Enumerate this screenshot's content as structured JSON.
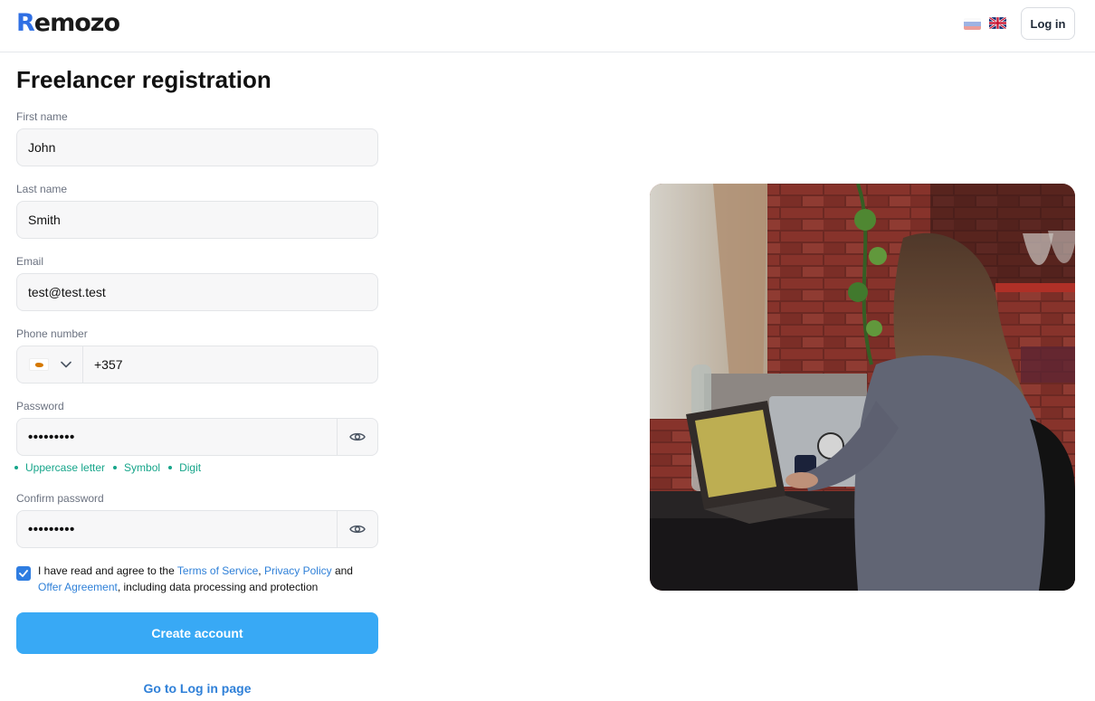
{
  "header": {
    "logo_initial": "R",
    "logo_rest": "emozo",
    "login_label": "Log in"
  },
  "form": {
    "title": "Freelancer registration",
    "first_name": {
      "label": "First name",
      "value": "John"
    },
    "last_name": {
      "label": "Last name",
      "value": "Smith"
    },
    "email": {
      "label": "Email",
      "value": "test@test.test"
    },
    "phone": {
      "label": "Phone number",
      "value": "+357"
    },
    "password": {
      "label": "Password",
      "value": "•••••••••"
    },
    "password_hints": [
      "Uppercase letter",
      "Symbol",
      "Digit"
    ],
    "confirm_password": {
      "label": "Confirm password",
      "value": "•••••••••"
    },
    "agreement": {
      "checked": true,
      "text_1": "I have read and agree to the ",
      "terms": "Terms of Service",
      "text_2": ", ",
      "privacy": "Privacy Policy",
      "text_3": " and ",
      "offer": "Offer Agreement",
      "text_4": ", including data processing and protection"
    },
    "submit_label": "Create account",
    "goto_login_label": "Go to Log in page"
  },
  "colors": {
    "accent": "#38a9f5",
    "link": "#2f80d8",
    "hint": "#16a58a",
    "logo_accent": "#2f6fe4"
  },
  "icons": {
    "phone_country_flag": "cyprus-flag-icon",
    "phone_dropdown": "chevron-down-icon",
    "password_toggle": "eye-icon",
    "language_ru": "russia-flag-icon",
    "language_en": "uk-flag-icon"
  }
}
